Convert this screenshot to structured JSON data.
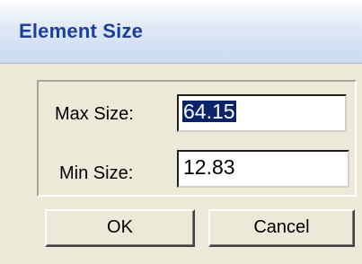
{
  "window": {
    "title": "Element Size"
  },
  "form": {
    "max_size": {
      "label": "Max Size:",
      "value": "64.15",
      "selected": true
    },
    "min_size": {
      "label": "Min Size:",
      "value": "12.83"
    }
  },
  "buttons": {
    "ok_label": "OK",
    "cancel_label": "Cancel"
  },
  "colors": {
    "title_text": "#1c3f9a",
    "selection_bg": "#0a246a",
    "dialog_bg": "#ece9d8"
  }
}
